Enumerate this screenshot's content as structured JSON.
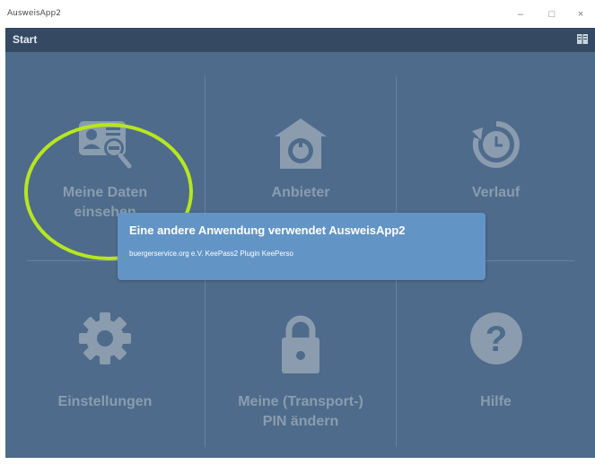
{
  "window": {
    "title": "AusweisApp2",
    "minimize_glyph": "–",
    "maximize_glyph": "□",
    "close_glyph": "×"
  },
  "appbar": {
    "title": "Start",
    "help_icon": "book-icon"
  },
  "tiles": [
    {
      "id": "meine-daten",
      "label_line1": "Meine Daten",
      "label_line2": "einsehen",
      "icon": "id-card-icon"
    },
    {
      "id": "anbieter",
      "label_line1": "Anbieter",
      "label_line2": "",
      "icon": "provider-house-icon"
    },
    {
      "id": "verlauf",
      "label_line1": "Verlauf",
      "label_line2": "",
      "icon": "history-clock-icon"
    },
    {
      "id": "einstellungen",
      "label_line1": "Einstellungen",
      "label_line2": "",
      "icon": "gear-icon"
    },
    {
      "id": "pin",
      "label_line1": "Meine (Transport-)",
      "label_line2": "PIN ändern",
      "icon": "lock-icon"
    },
    {
      "id": "hilfe",
      "label_line1": "Hilfe",
      "label_line2": "",
      "icon": "question-icon"
    }
  ],
  "dialog": {
    "title": "Eine andere Anwendung verwendet AusweisApp2",
    "text": "buergerservice.org e.V. KeePass2 Plugin KeePerso"
  },
  "colors": {
    "background": "#4e6b8b",
    "appbar": "#354a62",
    "tile_text": "#8a9cae",
    "highlight": "#b7e61f",
    "dialog": "#6394c6"
  }
}
